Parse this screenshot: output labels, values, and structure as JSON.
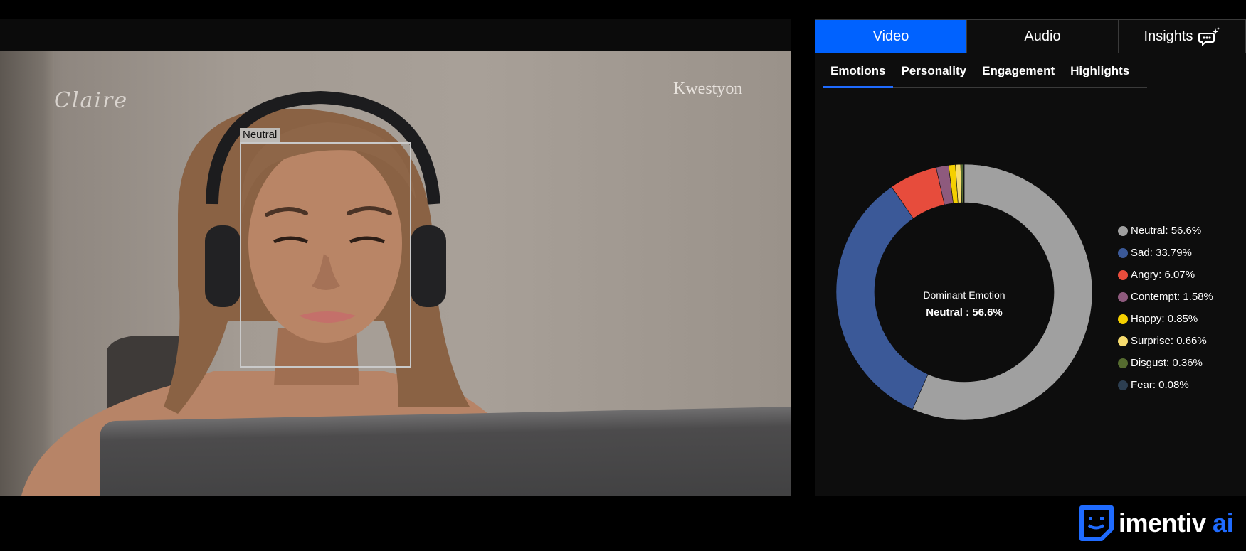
{
  "video": {
    "name_overlay": "Claire",
    "brand_overlay": "Kwestyon",
    "face_label": "Neutral"
  },
  "panel": {
    "tabs": [
      {
        "label": "Video",
        "active": true
      },
      {
        "label": "Audio",
        "active": false
      },
      {
        "label": "Insights",
        "active": false,
        "icon": "ai-chat-sparkle-icon"
      }
    ],
    "subtabs": [
      {
        "label": "Emotions",
        "active": true
      },
      {
        "label": "Personality",
        "active": false
      },
      {
        "label": "Engagement",
        "active": false
      },
      {
        "label": "Highlights",
        "active": false
      }
    ]
  },
  "chart_data": {
    "type": "pie",
    "variant": "donut",
    "center_title": "Dominant Emotion",
    "center_value": "Neutral : 56.6%",
    "legend_position": "right",
    "slices": [
      {
        "label": "Neutral",
        "value": 56.6,
        "legend": "Neutral: 56.6%",
        "color": "#a0a0a0"
      },
      {
        "label": "Sad",
        "value": 33.79,
        "legend": "Sad: 33.79%",
        "color": "#3b5998"
      },
      {
        "label": "Angry",
        "value": 6.07,
        "legend": "Angry: 6.07%",
        "color": "#e74c3c"
      },
      {
        "label": "Contempt",
        "value": 1.58,
        "legend": "Contempt: 1.58%",
        "color": "#8e5a7d"
      },
      {
        "label": "Happy",
        "value": 0.85,
        "legend": "Happy: 0.85%",
        "color": "#f5d000"
      },
      {
        "label": "Surprise",
        "value": 0.66,
        "legend": "Surprise: 0.66%",
        "color": "#f7dc6f"
      },
      {
        "label": "Disgust",
        "value": 0.36,
        "legend": "Disgust: 0.36%",
        "color": "#556b2f"
      },
      {
        "label": "Fear",
        "value": 0.08,
        "legend": "Fear: 0.08%",
        "color": "#2c3e50"
      }
    ]
  },
  "logo": {
    "brand": "imentiv",
    "suffix": " ai",
    "accent": "#1f6bff"
  }
}
